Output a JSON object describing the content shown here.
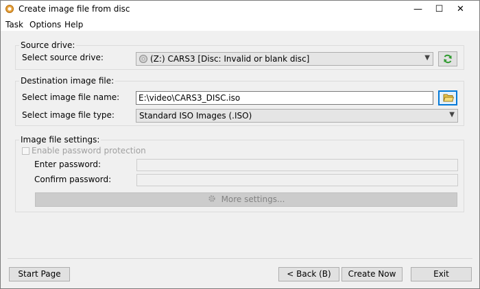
{
  "window": {
    "title": "Create image file from disc",
    "minimize_glyph": "—",
    "maximize_glyph": "☐",
    "close_glyph": "✕"
  },
  "menu": [
    "Task",
    "Options",
    "Help"
  ],
  "source_drive": {
    "legend": "Source drive:",
    "label": "Select source drive:",
    "value": "(Z:) CARS3 [Disc: Invalid or blank disc]"
  },
  "destination": {
    "legend": "Destination image file:",
    "name_label": "Select image file name:",
    "name_value": "E:\\video\\CARS3_DISC.iso",
    "type_label": "Select image file type:",
    "type_value": "Standard ISO Images (.ISO)"
  },
  "image_settings": {
    "legend": "Image file settings:",
    "password_checkbox": "Enable password protection",
    "enter_password_label": "Enter password:",
    "confirm_password_label": "Confirm password:",
    "more_settings": "More settings..."
  },
  "footer": {
    "start_page": "Start Page",
    "back": "< Back  (B)",
    "create_now": "Create Now",
    "exit": "Exit"
  },
  "icons": {
    "app": "disc-icon",
    "drive": "disc-drive-icon",
    "refresh": "refresh-icon",
    "folder": "folder-open-icon",
    "settings": "gear-icon"
  },
  "colors": {
    "focus": "#0078d7",
    "refresh_green": "#2e9a2e",
    "folder_yellow": "#e8c14a"
  }
}
